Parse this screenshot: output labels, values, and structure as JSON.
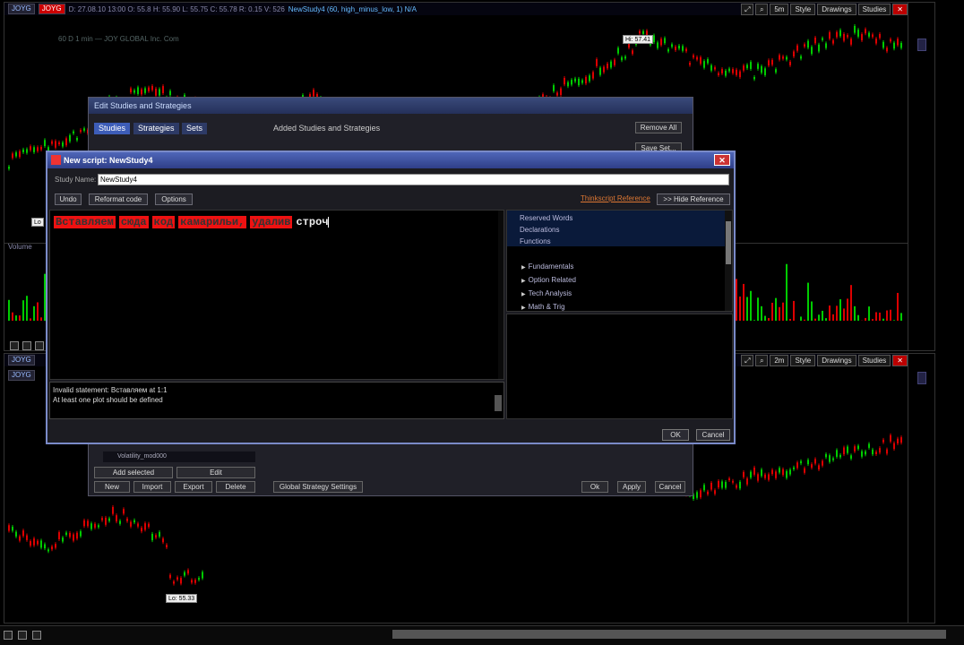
{
  "top_chart": {
    "symbols": [
      "JOYG",
      "JOYG"
    ],
    "info": "D: 27.08.10 13:00   O: 55.8   H: 55.90   L: 55.75   C: 55.78   R: 0.15   V: 526",
    "study": "NewStudy4 (60, high_minus_low, 1)  N/A",
    "sub_info": "60 D 1 min  —  JOY GLOBAL Inc. Com",
    "toolbar": {
      "interval": "5m",
      "style": "Style",
      "drawings": "Drawings",
      "studies": "Studies"
    },
    "hi_label": "Hi: 57.41",
    "lo_label": "Lo",
    "volume_label": "Volume"
  },
  "bottom_chart": {
    "symbols": [
      "JOYG",
      "JOYG"
    ],
    "toolbar": {
      "interval": "2m",
      "style": "Style",
      "drawings": "Drawings",
      "studies": "Studies"
    },
    "lo_label": "Lo: 55.33"
  },
  "bg_dialog": {
    "title": "Edit Studies and Strategies",
    "tabs": [
      "Studies",
      "Strategies",
      "Sets"
    ],
    "added_header": "Added Studies and Strategies",
    "remove_all": "Remove All",
    "save_set": "Save Set...",
    "study_item": "Volatility_mod000",
    "buttons_row1": [
      "Add selected",
      "Edit"
    ],
    "buttons_row2": [
      "New",
      "Import",
      "Export",
      "Delete"
    ],
    "global_settings": "Global Strategy Settings",
    "ok": "Ok",
    "apply": "Apply",
    "cancel": "Cancel"
  },
  "script_dialog": {
    "title": "New script: NewStudy4",
    "name_label": "Study Name:",
    "name_value": "NewStudy4",
    "buttons": [
      "Undo",
      "Reformat code",
      "Options"
    ],
    "ref_link": "Thinkscript Reference",
    "hide_ref": ">> Hide Reference",
    "editor_words": [
      "Вставляем",
      "сюда",
      "код",
      "камарильи,",
      "удалив"
    ],
    "editor_plain": "строч",
    "errors": [
      "Invalid statement: Вставляем at 1:1",
      "At least one plot should be defined"
    ],
    "ref_items": [
      "Reserved Words",
      "Declarations",
      "Functions"
    ],
    "ref_tree": [
      "Fundamentals",
      "Option Related",
      "Tech Analysis",
      "Math & Trig"
    ],
    "ok": "OK",
    "cancel": "Cancel"
  },
  "colors": {
    "accent": "#4f66b8",
    "up": "#00cc00",
    "down": "#dd0000",
    "highlight": "#e11111"
  }
}
